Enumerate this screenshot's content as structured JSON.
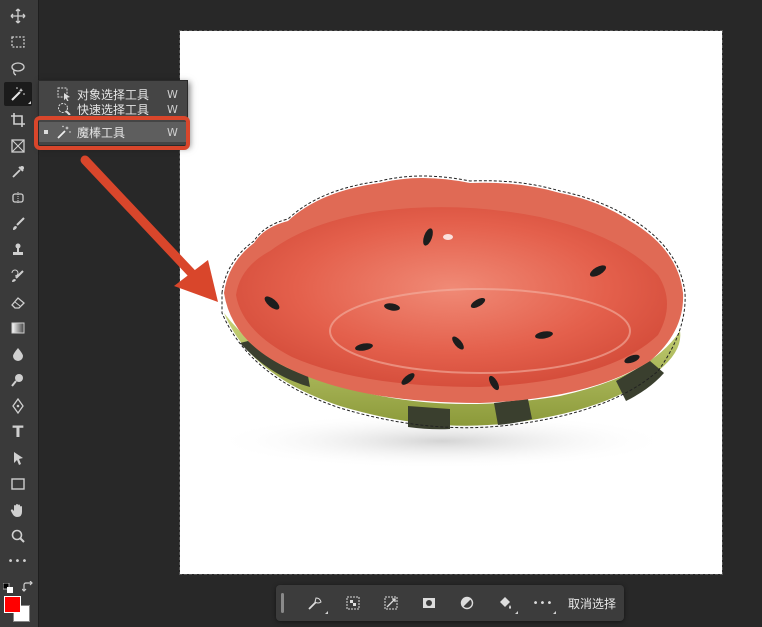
{
  "toolbar": {
    "tools": [
      "move-icon",
      "marquee-icon",
      "lasso-icon",
      "magic-wand-icon",
      "crop-icon",
      "frame-icon",
      "eyedropper-icon",
      "healing-brush-icon",
      "brush-icon",
      "stamp-icon",
      "history-brush-icon",
      "eraser-icon",
      "gradient-icon",
      "blur-icon",
      "dodge-icon",
      "pen-icon",
      "type-icon",
      "path-select-icon",
      "rectangle-icon",
      "hand-icon",
      "zoom-icon",
      "more-icon"
    ],
    "type_tool_label": "T",
    "more_label": "•••",
    "foreground_color": "#ff0000",
    "background_color": "#ffffff"
  },
  "flyout": {
    "items": [
      {
        "label": "对象选择工具",
        "key": "W",
        "icon": "object-selection-icon"
      },
      {
        "label": "快速选择工具",
        "key": "W",
        "icon": "quick-selection-icon"
      },
      {
        "label": "魔棒工具",
        "key": "W",
        "icon": "magic-wand-icon",
        "selected": true
      }
    ]
  },
  "annotation": {
    "highlight_color": "#d9462b",
    "arrow_color": "#d9462b"
  },
  "taskbar": {
    "buttons": [
      "select-subject-icon",
      "refine-edge-icon",
      "invert-selection-icon",
      "mask-icon",
      "adjustment-icon",
      "fill-icon",
      "more-icon"
    ],
    "more_label": "•••",
    "deselect_label": "取消选择"
  }
}
